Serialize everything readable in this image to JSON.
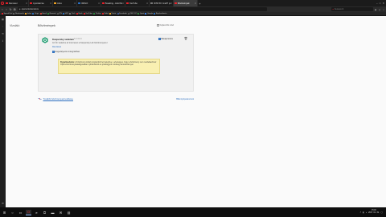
{
  "browser": {
    "tabs": [
      {
        "title": "Sitemeter",
        "color": "#e8202a",
        "active": false
      },
      {
        "title": "Gyorstárcsa",
        "color": "#e8202a",
        "active": false
      },
      {
        "title": "Index",
        "color": "#f5a623",
        "active": false
      },
      {
        "title": "ORIGO",
        "color": "#2a73c8",
        "active": false
      },
      {
        "title": "Breaking - Hold Remote Ins",
        "color": "#e8202a",
        "active": false
      },
      {
        "title": "YouTube",
        "color": "#e8202a",
        "active": false
      },
      {
        "title": "NOW 50: Íme87 például sor",
        "color": "#7a7a7a",
        "active": false
      },
      {
        "title": "Bővítmények",
        "color": "#e8202a",
        "active": true
      }
    ],
    "url": {
      "protocol": "opera://",
      "path": "opera://extensions"
    },
    "search_placeholder": "Keresés itt",
    "bookmarks": [
      {
        "label": "Speed Dial",
        "color": "#e8202a"
      },
      {
        "label": "Bookmarks",
        "color": "#666666"
      },
      {
        "label": "Index",
        "color": "#f5a623"
      },
      {
        "label": "Origo",
        "color": "#2a73c8"
      },
      {
        "label": "Gmail",
        "color": "#d44638"
      },
      {
        "label": "Nemzeti",
        "color": "#2c8a3e"
      },
      {
        "label": "IPS",
        "color": "#555555"
      },
      {
        "label": "H2O",
        "color": "#2a73c8"
      },
      {
        "label": "Tech",
        "color": "#7a7a7a"
      },
      {
        "label": "Hirek",
        "color": "#e8202a"
      },
      {
        "label": "YouTube",
        "color": "#e8202a"
      },
      {
        "label": "Térkép",
        "color": "#2c8a3e"
      },
      {
        "label": "Videó",
        "color": "#e8202a"
      },
      {
        "label": "Vásár",
        "color": "#f5a623"
      },
      {
        "label": "Facebook",
        "color": "#3b5998"
      },
      {
        "label": "OEO CO",
        "color": "#555555"
      },
      {
        "label": "Sport",
        "color": "#2c8a3e"
      },
      {
        "label": "Google",
        "color": "#4285f4"
      },
      {
        "label": "Bejelentkezés",
        "color": "#2a73c8"
      }
    ]
  },
  "sidebar": {
    "icons": [
      "speed-dial-icon",
      "messenger-icon",
      "history-icon",
      "downloads-icon",
      "settings-icon"
    ]
  },
  "page": {
    "left_nav_label": "Vizsláló",
    "title": "Bővítmények",
    "dev_mode_label": "Fejlesztői mód"
  },
  "extension": {
    "name": "Kaspersky védelem",
    "version": "5.0.60.0",
    "description": "Az Ön védelme az interneten a Kaspersky Lab bővítményével",
    "details_link": "Részletek",
    "private_label": "Engedélyezés inkognitóban",
    "enabled_label": "Bekapcsolva",
    "warning_title": "Figyelmeztetés:",
    "warning_text": "A bővítmény külső programból lett telepítve. Lehetséges, hogy a bővítmény nem rendelkezik az Opera bővítménykatalógusában nyilvántartott és jóváhagyott minőségi tanúsítvánnyal.",
    "icon_color": "#1a9b6e"
  },
  "footer": {
    "get_more_link": "További bővítmények letöltése",
    "shortcuts_link": "Billentyűparancsok"
  },
  "taskbar": {
    "items": [
      "windows-start-icon",
      "search-icon",
      "task-view-icon",
      "opera-taskbar-icon",
      "explorer-icon",
      "store-icon",
      "folder-icon",
      "mail-icon",
      "calendar-icon"
    ],
    "time": "15:03",
    "date": "2017. 01. 19."
  }
}
